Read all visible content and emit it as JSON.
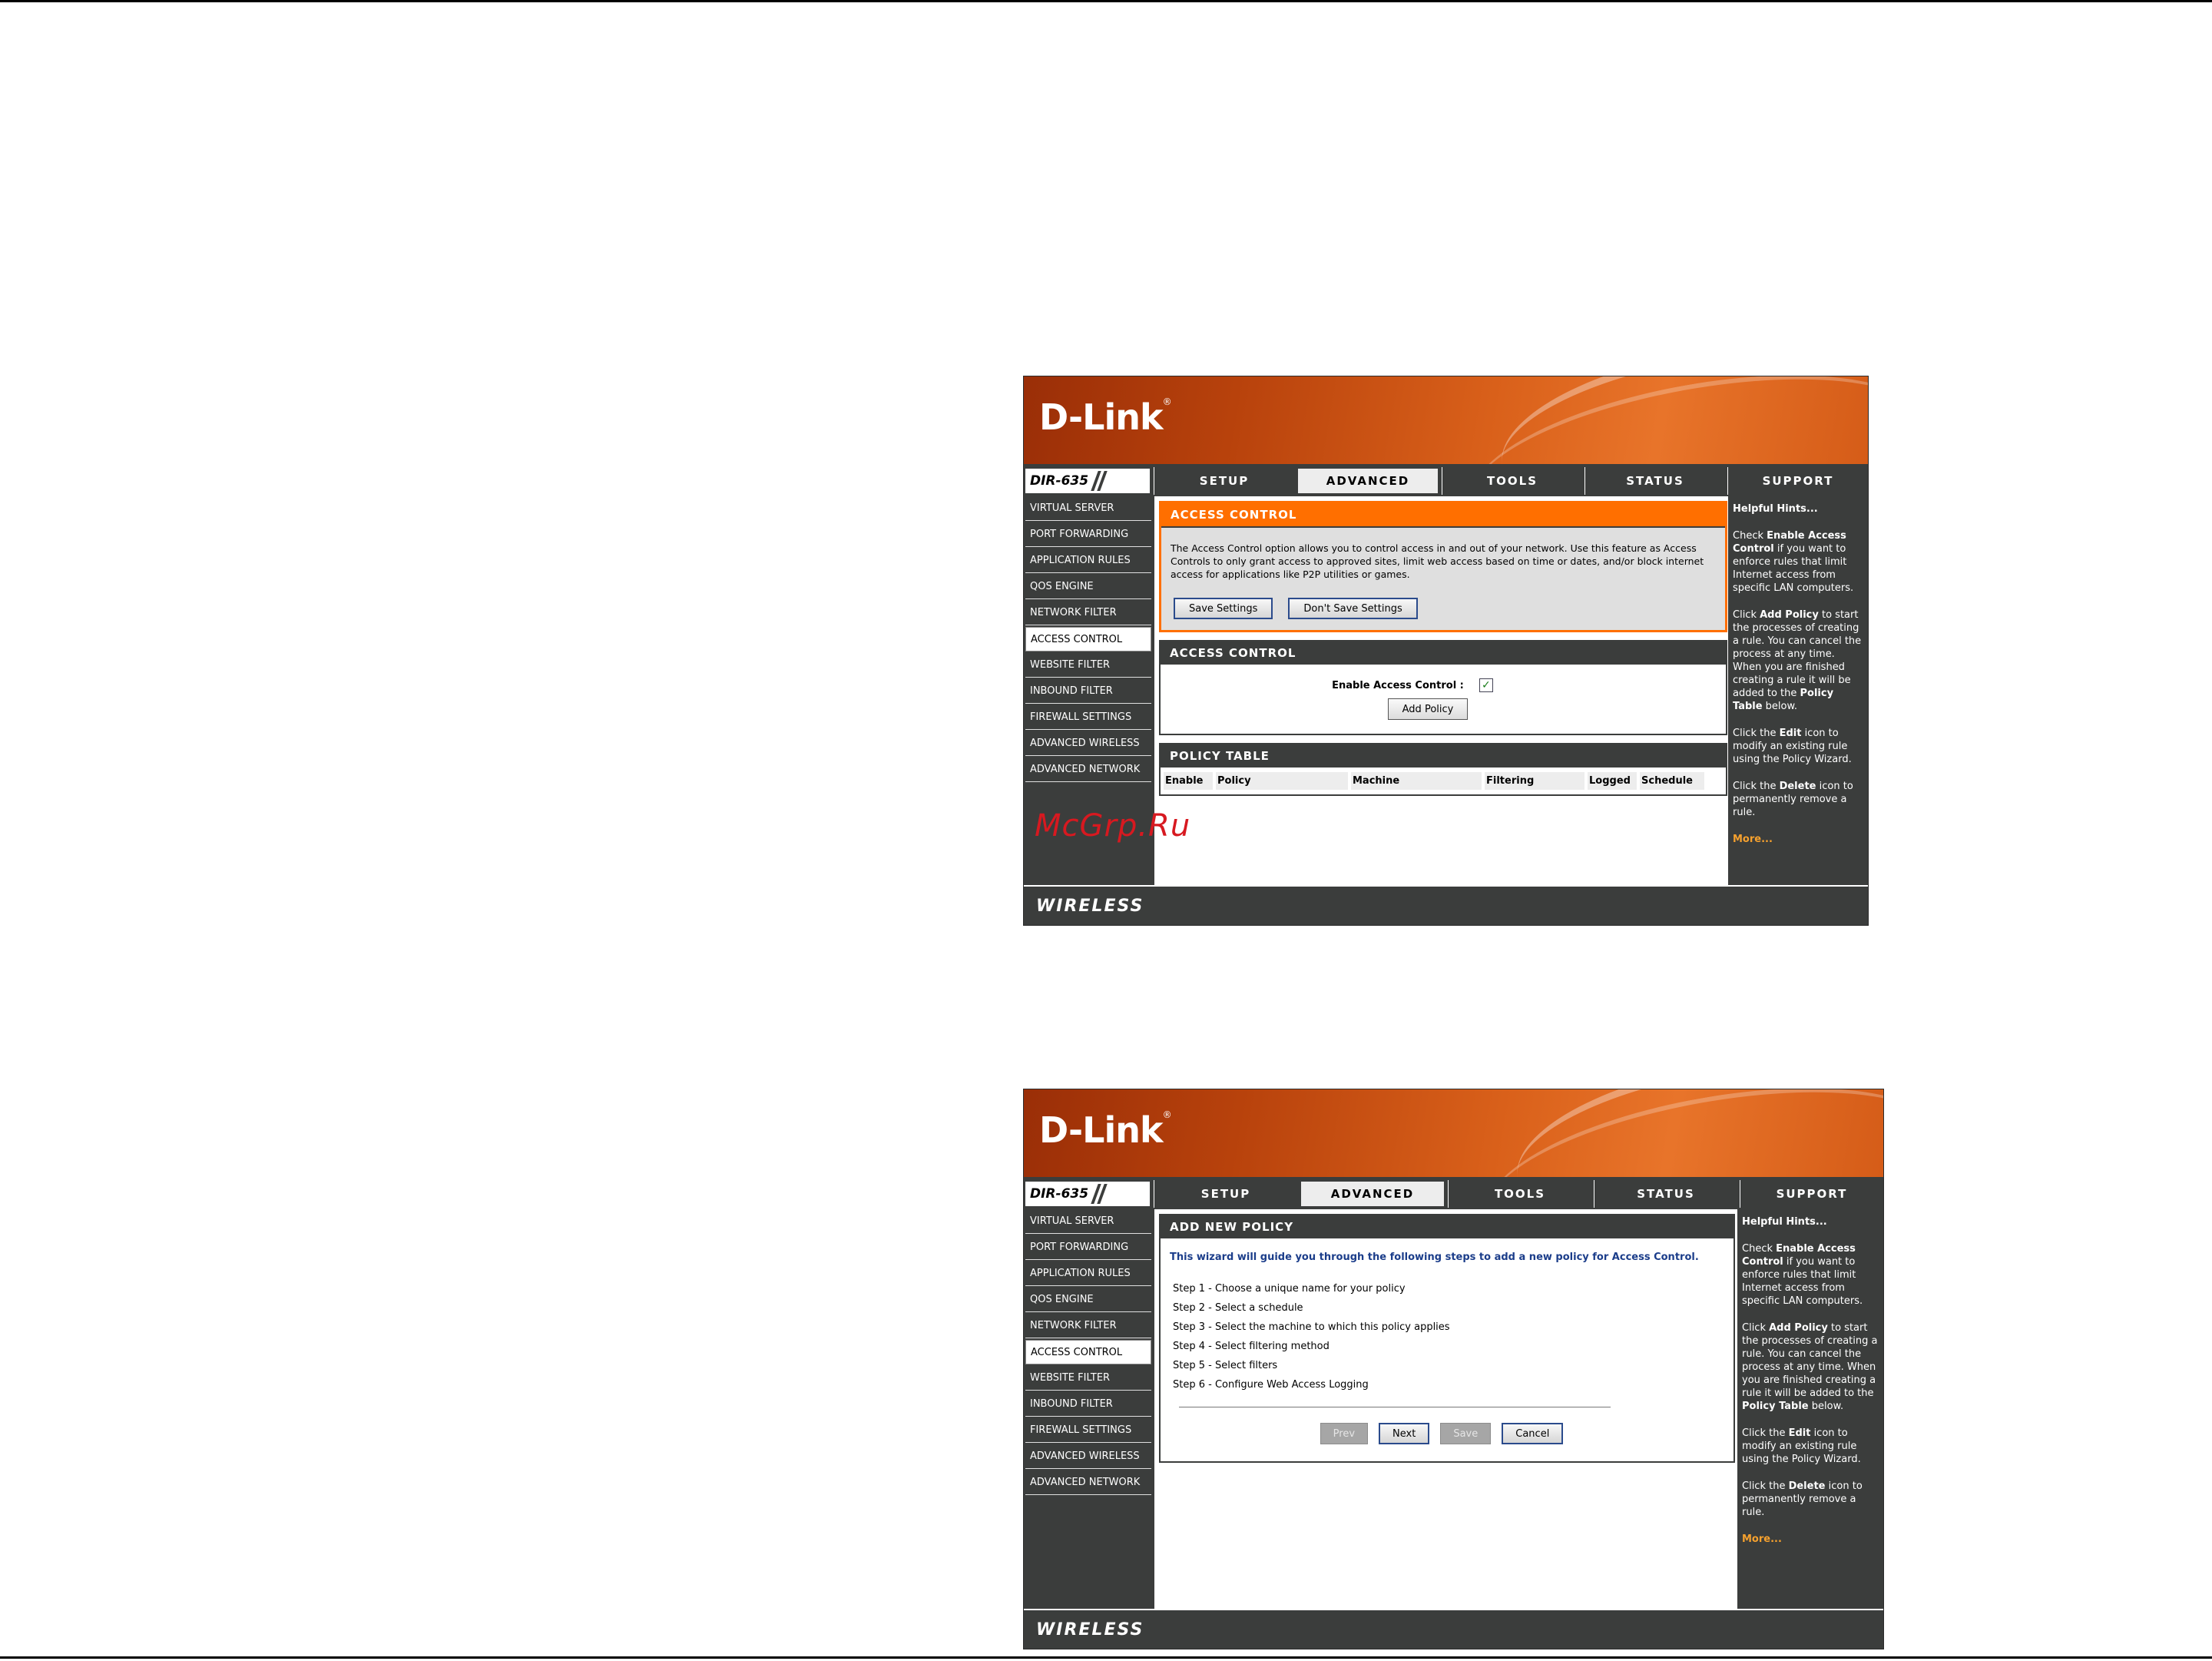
{
  "brand": {
    "logo": "D-Link",
    "model": "DIR-635",
    "footer": "WIRELESS"
  },
  "nav_tabs": [
    "SETUP",
    "ADVANCED",
    "TOOLS",
    "STATUS",
    "SUPPORT"
  ],
  "active_tab": "ADVANCED",
  "sidebar": [
    "VIRTUAL SERVER",
    "PORT FORWARDING",
    "APPLICATION RULES",
    "QOS ENGINE",
    "NETWORK FILTER",
    "ACCESS CONTROL",
    "WEBSITE FILTER",
    "INBOUND FILTER",
    "FIREWALL SETTINGS",
    "ADVANCED WIRELESS",
    "ADVANCED NETWORK"
  ],
  "active_sidebar": "ACCESS CONTROL",
  "hints": {
    "title": "Helpful Hints...",
    "h1_a": "Check ",
    "h1_b": "Enable Access Control",
    "h1_c": " if you want to enforce rules that limit Internet access from specific LAN computers.",
    "h2_a": "Click ",
    "h2_b": "Add Policy",
    "h2_c": " to start the processes of creating a rule. You can cancel the process at any time. When you are finished creating a rule it will be added to the ",
    "h2_d": "Policy Table",
    "h2_e": " below.",
    "h3_a": "Click the ",
    "h3_b": "Edit",
    "h3_c": " icon to modify an existing rule using the Policy Wizard.",
    "h4_a": "Click the ",
    "h4_b": "Delete",
    "h4_c": " icon to permanently remove a rule.",
    "more": "More..."
  },
  "screen1": {
    "intro_title": "ACCESS CONTROL",
    "intro_text": "The Access Control option allows you to control access in and out of your network. Use this feature as Access Controls to only grant access to approved sites, limit web access based on time or dates, and/or block internet access for applications like P2P utilities or games.",
    "save_button": "Save Settings",
    "dont_save_button": "Don't Save Settings",
    "section_title": "ACCESS CONTROL",
    "enable_label": "Enable Access Control :",
    "enable_checked": true,
    "add_policy_button": "Add Policy",
    "policy_table_title": "POLICY TABLE",
    "policy_columns": [
      "Enable",
      "Policy",
      "Machine",
      "Filtering",
      "Logged",
      "Schedule"
    ]
  },
  "screen2": {
    "title": "ADD NEW POLICY",
    "intro": "This wizard will guide you through the following steps to add a new policy for Access Control.",
    "steps": [
      "Step 1 - Choose a unique name for your policy",
      "Step 2 - Select a schedule",
      "Step 3 - Select the machine to which this policy applies",
      "Step 4 - Select filtering method",
      "Step 5 - Select filters",
      "Step 6 - Configure Web Access Logging"
    ],
    "buttons": {
      "prev": "Prev",
      "next": "Next",
      "save": "Save",
      "cancel": "Cancel"
    }
  },
  "watermark": "McGrp.Ru"
}
